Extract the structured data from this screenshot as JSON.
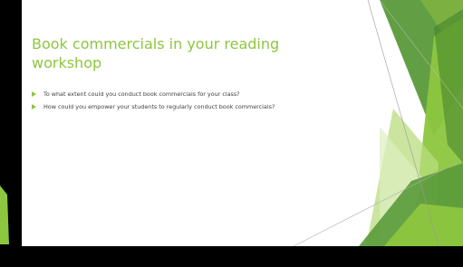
{
  "slide": {
    "title": "Book commercials in your reading workshop",
    "bullets": [
      "To what extent could you conduct book commercials for your class?",
      "How could you empower your students to regularly conduct book commercials?"
    ]
  },
  "colors": {
    "accent": "#8dc63f",
    "accent_dark": "#3f7f2a",
    "accent_light": "#c9e49a",
    "text": "#404040",
    "background": "#ffffff",
    "frame": "#000000"
  }
}
